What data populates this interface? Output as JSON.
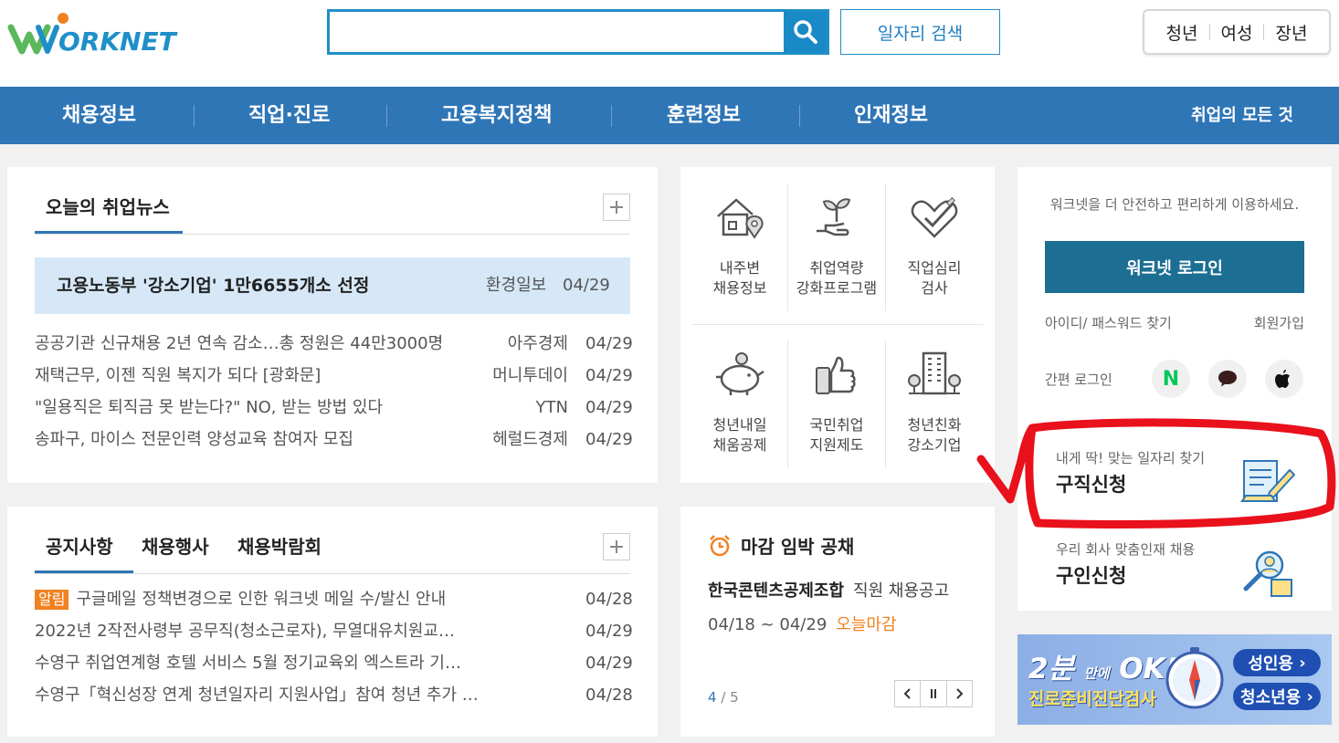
{
  "brand": {
    "logo_text": "WORKNET",
    "accent": "#2f76b7",
    "highlight_color": "#f08221"
  },
  "header": {
    "search_placeholder": "",
    "job_search_label": "일자리 검색",
    "targets": [
      "청년",
      "여성",
      "장년"
    ]
  },
  "nav": {
    "items": [
      "채용정보",
      "직업·진로",
      "고용복지정책",
      "훈련정보",
      "인재정보"
    ],
    "right_label": "취업의 모든 것"
  },
  "news": {
    "tab_label": "오늘의 취업뉴스",
    "headline": {
      "title": "고용노동부 '강소기업' 1만6655개소 선정",
      "source": "환경일보",
      "date": "04/29"
    },
    "items": [
      {
        "title": "공공기관 신규채용 2년 연속 감소…총 정원은 44만3000명",
        "source": "아주경제",
        "date": "04/29"
      },
      {
        "title": "재택근무, 이젠 직원 복지가 되다 [광화문]",
        "source": "머니투데이",
        "date": "04/29"
      },
      {
        "title": "\"일용직은 퇴직금 못 받는다?\" NO, 받는 방법 있다",
        "source": "YTN",
        "date": "04/29"
      },
      {
        "title": "송파구, 마이스 전문인력 양성교육 참여자 모집",
        "source": "헤럴드경제",
        "date": "04/29"
      }
    ]
  },
  "notices": {
    "tabs": [
      "공지사항",
      "채용행사",
      "채용박람회"
    ],
    "badge": "알림",
    "items": [
      {
        "title": "구글메일 정책변경으로 인한 워크넷 메일 수/발신 안내",
        "date": "04/28"
      },
      {
        "title": "2022년 2작전사령부 공무직(청소근로자), 무열대유치원교…",
        "date": "04/29"
      },
      {
        "title": "수영구 취업연계형 호텔 서비스 5월 정기교육외 엑스트라 기…",
        "date": "04/29"
      },
      {
        "title": "수영구「혁신성장 연계 청년일자리 지원사업」참여 청년 추가 …",
        "date": "04/28"
      }
    ]
  },
  "quick_menu": [
    {
      "line1": "내주변",
      "line2": "채용정보",
      "icon": "house-location-icon"
    },
    {
      "line1": "취업역량",
      "line2": "강화프로그램",
      "icon": "sprout-hand-icon"
    },
    {
      "line1": "직업심리",
      "line2": "검사",
      "icon": "heart-check-icon"
    },
    {
      "line1": "청년내일",
      "line2": "채움공제",
      "icon": "piggy-bank-icon"
    },
    {
      "line1": "국민취업",
      "line2": "지원제도",
      "icon": "thumbs-up-phone-icon"
    },
    {
      "line1": "청년친화",
      "line2": "강소기업",
      "icon": "building-tree-icon"
    }
  ],
  "deadline": {
    "title": "마감 임박 공채",
    "company": "한국콘텐츠공제조합",
    "position": "직원 채용공고",
    "period": "04/18 ~ 04/29",
    "status": "오늘마감",
    "page_current": "4",
    "page_total": "/ 5"
  },
  "login": {
    "message": "워크넷을 더 안전하고 편리하게 이용하세요.",
    "button": "워크넷 로그인",
    "find_link": "아이디/ 패스워드 찾기",
    "join_link": "회원가입",
    "easy_label": "간편 로그인",
    "sns": [
      "naver-icon",
      "kakao-icon",
      "apple-icon"
    ],
    "naver_glyph": "N"
  },
  "apply": [
    {
      "sub": "내게 딱! 맞는 일자리 찾기",
      "main": "구직신청",
      "icon": "form-pen-icon"
    },
    {
      "sub": "우리 회사 맞춤인재 채용",
      "main": "구인신청",
      "icon": "person-search-icon"
    }
  ],
  "banner": {
    "big_num": "2분",
    "big_small": "만에",
    "big_ok": "OK!",
    "subtitle": "진로준비진단검사",
    "btn_adult": "성인용",
    "btn_youth": "청소년용"
  }
}
